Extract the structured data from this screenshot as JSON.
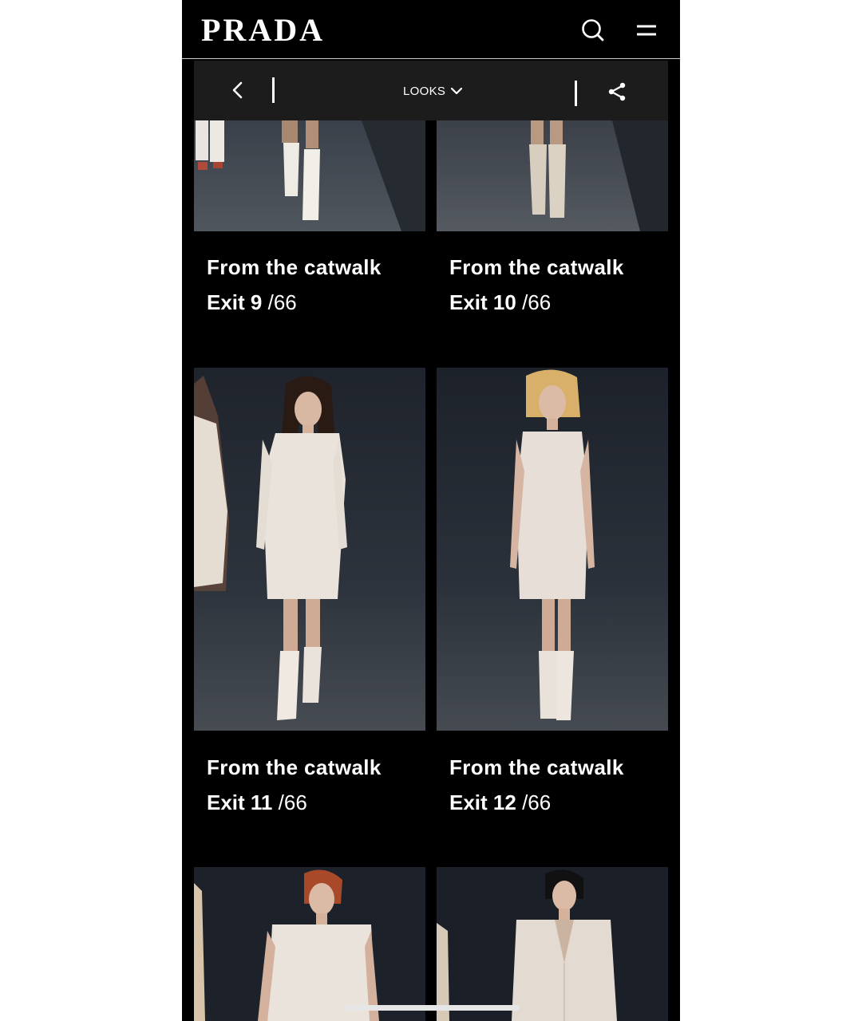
{
  "brand": {
    "logo_text": "PRADA"
  },
  "header": {
    "search_icon": "search-icon",
    "menu_icon": "menu-icon"
  },
  "toolbar": {
    "back_icon": "chevron-left-icon",
    "looks_label": "LOOKS",
    "dropdown_icon": "chevron-down-icon",
    "share_icon": "share-icon"
  },
  "looks": [
    {
      "title": "From the catwalk",
      "exit": "Exit 9",
      "total": "/66"
    },
    {
      "title": "From the catwalk",
      "exit": "Exit 10",
      "total": "/66"
    },
    {
      "title": "From the catwalk",
      "exit": "Exit 11",
      "total": "/66"
    },
    {
      "title": "From the catwalk",
      "exit": "Exit 12",
      "total": "/66"
    }
  ],
  "colors": {
    "background": "#000000",
    "toolbar": "#1c1c1c",
    "text": "#ffffff"
  }
}
